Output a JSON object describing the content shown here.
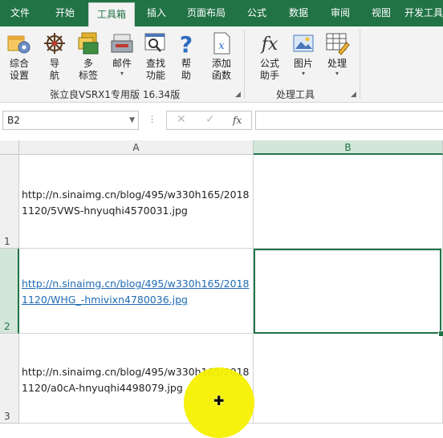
{
  "ribbon_tabs": [
    "文件",
    "开始",
    "工具箱",
    "插入",
    "页面布局",
    "公式",
    "数据",
    "审阅",
    "视图",
    "开发工具"
  ],
  "ribbon": {
    "group1": {
      "buttons": [
        {
          "label": "综合\n设置",
          "icon": "gear-box-icon"
        },
        {
          "label": "导\n航",
          "icon": "ship-wheel-icon"
        },
        {
          "label": "多\n标签",
          "icon": "multi-tab-icon"
        },
        {
          "label": "邮件",
          "icon": "mail-icon"
        },
        {
          "label": "查找\n功能",
          "icon": "search-window-icon"
        },
        {
          "label": "帮\n助",
          "icon": "help-icon"
        },
        {
          "label": "添加\n函数",
          "icon": "function-doc-icon"
        }
      ],
      "label": "张立良VSRX1专用版 16.34版"
    },
    "group2": {
      "buttons": [
        {
          "label": "公式\n助手",
          "icon": "fx-icon"
        },
        {
          "label": "图片",
          "icon": "picture-icon"
        },
        {
          "label": "处理",
          "icon": "table-pencil-icon"
        }
      ],
      "label": "处理工具"
    }
  },
  "formula_bar": {
    "name_box": "B2",
    "cancel_symbol": "✕",
    "enter_symbol": "✓",
    "fx_label": "fx",
    "formula_value": ""
  },
  "columns": [
    "A",
    "B"
  ],
  "rows": [
    {
      "number": "1",
      "a": "http://n.sinaimg.cn/blog/495/w330h165/20181120/5VWS-hnyuqhi4570031.jpg",
      "a_is_link": false,
      "b": ""
    },
    {
      "number": "2",
      "a": "http://n.sinaimg.cn/blog/495/w330h165/20181120/WHG_-hmivixn4780036.jpg",
      "a_is_link": true,
      "b": ""
    },
    {
      "number": "3",
      "a": "http://n.sinaimg.cn/blog/495/w330h165/20181120/a0cA-hnyuqhi4498079.jpg",
      "a_is_link": false,
      "b": ""
    }
  ],
  "selected_cell": "B2",
  "colors": {
    "accent": "#217346",
    "link": "#1f6bb5",
    "cursor_highlight": "#f5f000"
  }
}
